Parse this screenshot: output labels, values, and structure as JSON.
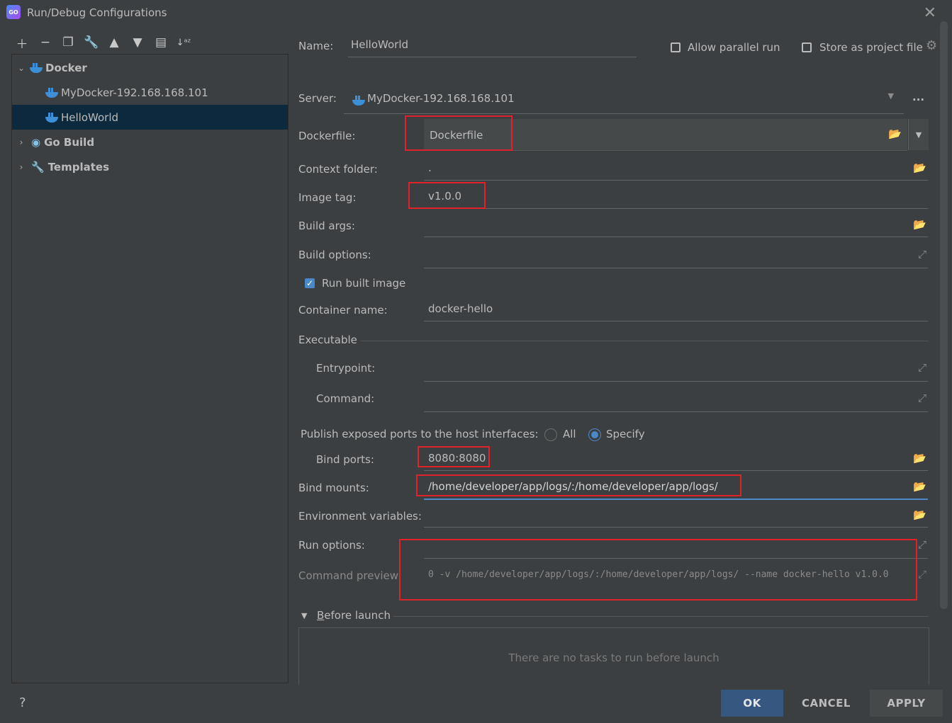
{
  "window": {
    "title": "Run/Debug Configurations",
    "app_icon": "GO"
  },
  "toolbar": {
    "icons": [
      "plus-icon",
      "minus-icon",
      "copy-icon",
      "wrench-icon",
      "arrow-up-icon",
      "arrow-down-icon",
      "folder-add-icon",
      "sort-alpha-icon"
    ]
  },
  "tree": {
    "docker": "Docker",
    "docker_child_1": "MyDocker-192.168.168.101",
    "docker_child_2": "HelloWorld",
    "go_build": "Go Build",
    "templates": "Templates"
  },
  "form": {
    "name_label": "Name:",
    "name_value": "HelloWorld",
    "allow_parallel": "Allow parallel run",
    "store_project": "Store as project file",
    "server_label": "Server:",
    "server_value": "MyDocker-192.168.168.101",
    "server_more": "...",
    "dockerfile_label": "Dockerfile:",
    "dockerfile_value": "Dockerfile",
    "context_label": "Context folder:",
    "context_value": ".",
    "image_tag_label": "Image tag:",
    "image_tag_value": "v1.0.0",
    "build_args_label": "Build args:",
    "build_options_label": "Build options:",
    "run_built_label": "Run built image",
    "container_name_label": "Container name:",
    "container_name_value": "docker-hello",
    "executable_label": "Executable",
    "entrypoint_label": "Entrypoint:",
    "command_label": "Command:",
    "publish_label": "Publish exposed ports to the host interfaces:",
    "radio_all": "All",
    "radio_specify": "Specify",
    "bind_ports_label": "Bind ports:",
    "bind_ports_value": "8080:8080",
    "bind_mounts_label": "Bind mounts:",
    "bind_mounts_value": "/home/developer/app/logs/:/home/developer/app/logs/",
    "env_label": "Environment variables:",
    "run_options_label": "Run options:",
    "preview_label": "Command preview:",
    "preview_value": "0 -v /home/developer/app/logs/:/home/developer/app/logs/ --name docker-hello v1.0.0",
    "before_launch_label": "Before launch",
    "before_launch_empty": "There are no tasks to run before launch"
  },
  "footer": {
    "help": "?",
    "ok": "OK",
    "cancel": "CANCEL",
    "apply": "APPLY"
  },
  "colors": {
    "background": "#3c3f41",
    "selection": "#0d293e",
    "accent": "#4a88c7",
    "ok_button": "#365880",
    "highlight_box": "#e0222a"
  }
}
